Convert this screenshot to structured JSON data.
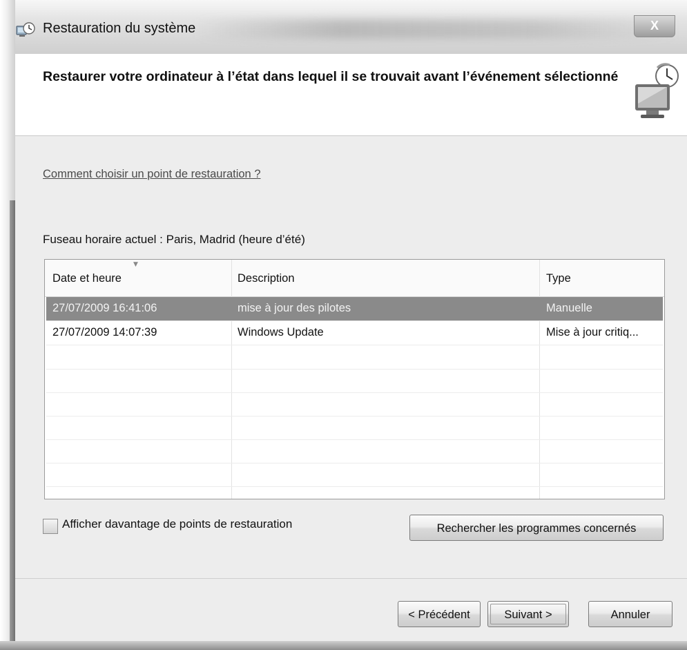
{
  "window": {
    "title": "Restauration du système",
    "close_label": "X"
  },
  "header": {
    "heading": "Restaurer votre ordinateur à l’état dans lequel il se trouvait avant l’événement sélectionné"
  },
  "content": {
    "help_link": "Comment choisir un point de restauration ?",
    "timezone": "Fuseau horaire actuel : Paris, Madrid (heure d’été)",
    "columns": [
      "Date et heure",
      "Description",
      "Type"
    ],
    "rows": [
      {
        "date": "27/07/2009 16:41:06",
        "description": "mise à jour des pilotes",
        "type": "Manuelle",
        "selected": true
      },
      {
        "date": "27/07/2009 14:07:39",
        "description": "Windows Update",
        "type": "Mise à jour critiq...",
        "selected": false
      }
    ],
    "checkbox_label": "Afficher davantage de points de restauration",
    "search_button": "Rechercher les programmes concernés"
  },
  "footer": {
    "previous_button": "< Précédent",
    "next_button": "Suivant >",
    "cancel_button": "Annuler"
  },
  "colors": {
    "selection": "#8a8a8a",
    "window_bg": "#ededed"
  }
}
